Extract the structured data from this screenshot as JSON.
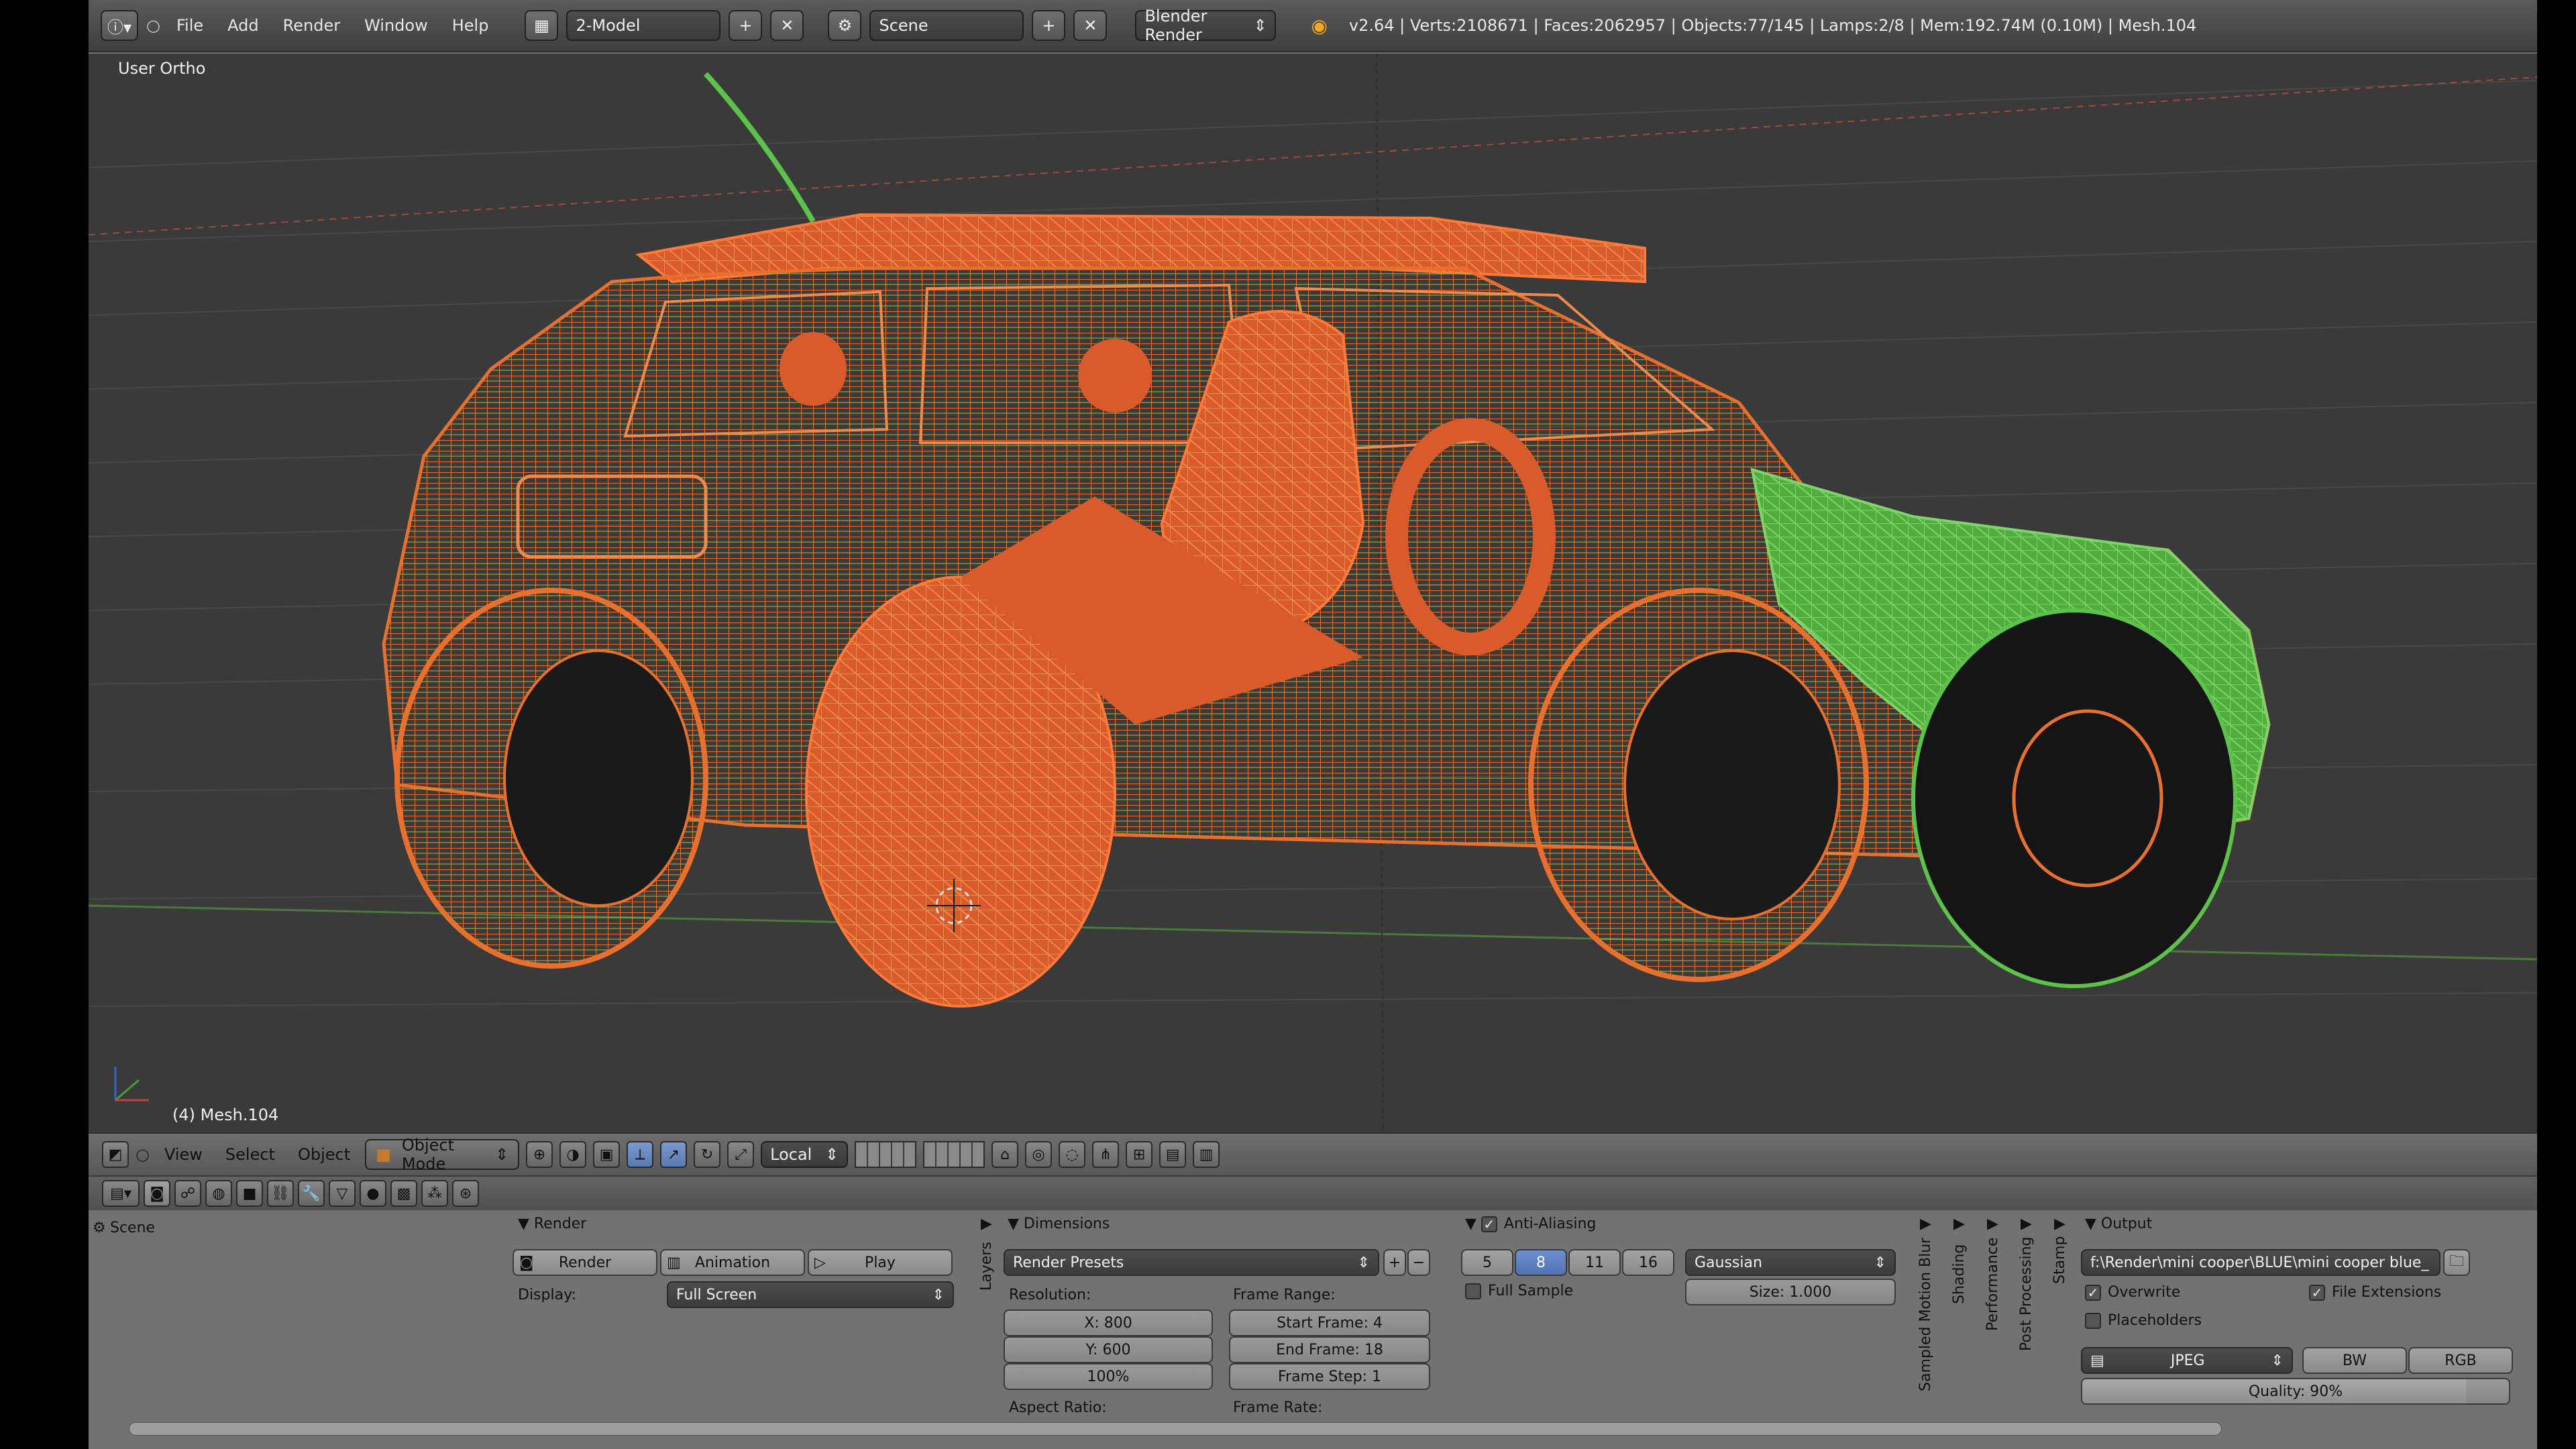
{
  "header": {
    "menus": [
      "File",
      "Add",
      "Render",
      "Window",
      "Help"
    ],
    "screen_layout": "2-Model",
    "scene": "Scene",
    "engine": "Blender Render",
    "stats": "v2.64 | Verts:2108671 | Faces:2062957 | Objects:77/145 | Lamps:2/8 | Mem:192.74M (0.10M) | Mesh.104"
  },
  "viewport": {
    "view_label": "User Ortho",
    "object_label": "(4) Mesh.104",
    "colors": {
      "background": "#3a3a3a",
      "selected_wire": "#e8602c",
      "active_wire": "#5cc24a",
      "grid": "#474747"
    }
  },
  "viewport_header": {
    "menus": [
      "View",
      "Select",
      "Object"
    ],
    "mode": "Object Mode",
    "orientation": "Local"
  },
  "properties": {
    "context": "Scene",
    "render": {
      "title": "Render",
      "render_button": "Render",
      "animation_button": "Animation",
      "play_button": "Play",
      "display_label": "Display:",
      "display_value": "Full Screen"
    },
    "layers_tab": "Layers",
    "dimensions": {
      "title": "Dimensions",
      "presets": "Render Presets",
      "resolution_label": "Resolution:",
      "res_x": "X: 800",
      "res_y": "Y: 600",
      "res_pct": "100%",
      "aspect_label": "Aspect Ratio:",
      "frame_range_label": "Frame Range:",
      "start": "Start Frame: 4",
      "end": "End Frame: 18",
      "step": "Frame Step: 1",
      "frame_rate_label": "Frame Rate:"
    },
    "anti_aliasing": {
      "title": "Anti-Aliasing",
      "samples": [
        "5",
        "8",
        "11",
        "16"
      ],
      "selected": "8",
      "full_sample": "Full Sample",
      "filter": "Gaussian",
      "size": "Size: 1.000"
    },
    "collapsed_panels": [
      "Sampled Motion Blur",
      "Shading",
      "Performance",
      "Post Processing",
      "Stamp"
    ],
    "output": {
      "title": "Output",
      "path": "f:\\Render\\mini cooper\\BLUE\\mini cooper blue_",
      "overwrite": "Overwrite",
      "file_extensions": "File Extensions",
      "placeholders": "Placeholders",
      "format": "JPEG",
      "bw": "BW",
      "rgb": "RGB",
      "quality": "Quality: 90%"
    }
  }
}
